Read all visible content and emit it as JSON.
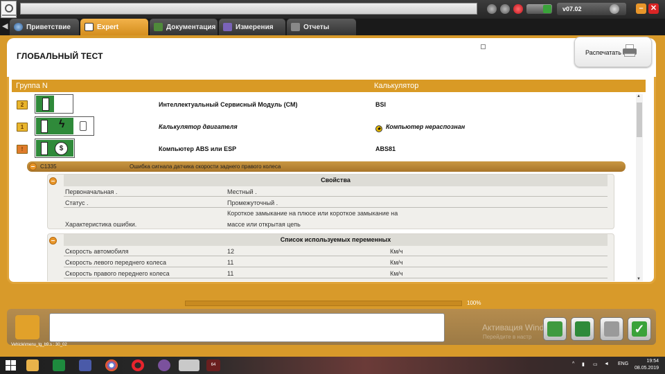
{
  "app": {
    "version": "v07.02",
    "colors": {
      "accent": "#d89a2a",
      "active_tab": "#e6a23a"
    }
  },
  "tabs": [
    {
      "label": "Приветствие",
      "icon": "globe-icon"
    },
    {
      "label": "Expert",
      "icon": "magnifier-icon",
      "active": true
    },
    {
      "label": "Документация",
      "icon": "book-icon"
    },
    {
      "label": "Измерения",
      "icon": "wave-icon"
    },
    {
      "label": "Отчеты",
      "icon": "report-icon"
    }
  ],
  "page": {
    "title": "ГЛОБАЛЬНЫЙ ТЕСТ",
    "print_label": "Распечатать"
  },
  "table": {
    "col_group": "Группа N",
    "col_calc": "Калькулятор",
    "rows": [
      {
        "folder": "2",
        "name": "Интеллектуальный Сервисный Модуль (СМ)",
        "calc": "BSI",
        "italic": false
      },
      {
        "folder": "1",
        "name": "Калькулятор двигателя",
        "calc": "Компьютер нераспознан",
        "italic": true
      },
      {
        "folder": "!",
        "name": "Компьютер ABS или ESP",
        "calc": "ABS81",
        "italic": false
      }
    ]
  },
  "fault": {
    "code": "C1335",
    "description": "Ошибка сигнала датчика скорости заднего правого колеса"
  },
  "properties": {
    "title": "Свойства",
    "rows": [
      {
        "key": "Первоначальная .",
        "value": "Местный ."
      },
      {
        "key": "Статус .",
        "value": "Промежуточный ."
      },
      {
        "key": "Характеристика ошибки.",
        "value_line1": "Короткое замыкание на плюсе или короткое замыкание на",
        "value_line2": "массе или открытая цепь"
      }
    ]
  },
  "variables": {
    "title": "Список используемых переменных",
    "rows": [
      {
        "key": "Скорость автомобиля",
        "value": "12",
        "unit": "Км/ч"
      },
      {
        "key": "Скорость левого переднего колеса",
        "value": "11",
        "unit": "Км/ч"
      },
      {
        "key": "Скорость правого переднего колеса",
        "value": "11",
        "unit": "Км/ч"
      }
    ]
  },
  "progress": {
    "value": 100,
    "label": "100%"
  },
  "footer": {
    "path": "Vehicle\\menu_tg_b9.s : 30_02",
    "watermark_line1": "Активация Windo",
    "watermark_line2": "Перейдите в настр"
  },
  "taskbar": {
    "lang": "ENG",
    "time": "19:54",
    "date": "08.05.2019",
    "badge": "64"
  }
}
